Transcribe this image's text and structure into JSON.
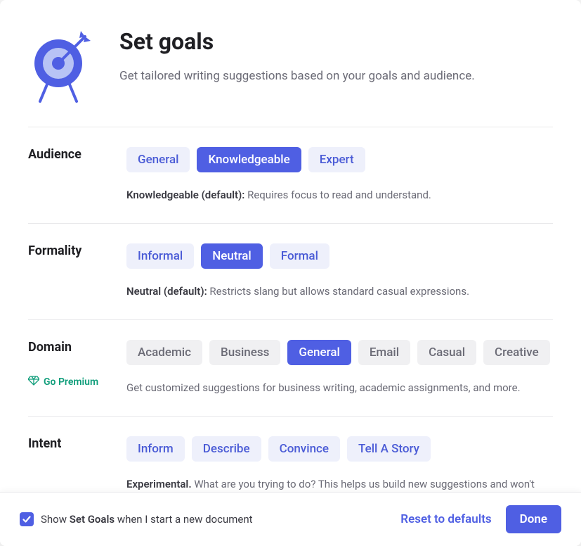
{
  "header": {
    "title": "Set goals",
    "subtitle": "Get tailored writing suggestions based on your goals and audience."
  },
  "audience": {
    "label": "Audience",
    "options": [
      "General",
      "Knowledgeable",
      "Expert"
    ],
    "selected_index": 1,
    "desc_strong": "Knowledgeable (default):",
    "desc_rest": " Requires focus to read and understand."
  },
  "formality": {
    "label": "Formality",
    "options": [
      "Informal",
      "Neutral",
      "Formal"
    ],
    "selected_index": 1,
    "desc_strong": "Neutral (default):",
    "desc_rest": " Restricts slang but allows standard casual expressions."
  },
  "domain": {
    "label": "Domain",
    "premium_label": "Go Premium",
    "options": [
      "Academic",
      "Business",
      "General",
      "Email",
      "Casual",
      "Creative"
    ],
    "selected_index": 2,
    "desc": "Get customized suggestions for business writing, academic assignments, and more."
  },
  "intent": {
    "label": "Intent",
    "options": [
      "Inform",
      "Describe",
      "Convince",
      "Tell A Story"
    ],
    "selected_index": -1,
    "desc_strong": "Experimental.",
    "desc_rest": " What are you trying to do? This helps us build new suggestions and won't affect your feedback today."
  },
  "footer": {
    "checkbox_checked": true,
    "check_pre": "Show ",
    "check_strong": "Set Goals",
    "check_post": " when I start a new document",
    "reset": "Reset to defaults",
    "done": "Done"
  }
}
